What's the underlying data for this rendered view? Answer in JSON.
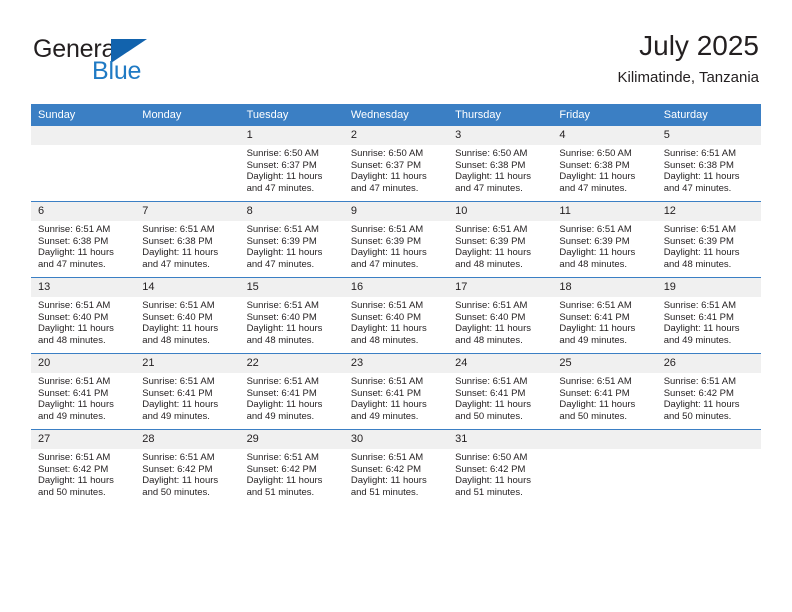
{
  "brand": {
    "name_top": "General",
    "name_bottom": "Blue",
    "logo_icon": "blue-triangle-flag-icon",
    "color_dark": "#231f20",
    "color_blue": "#1f7ac4",
    "color_flag": "#1263ad"
  },
  "header": {
    "title": "July 2025",
    "subtitle": "Kilimatinde, Tanzania"
  },
  "theme": {
    "header_row_bg": "#3b7fc4",
    "daynum_bg": "#f0f0f0",
    "text": "#231f20"
  },
  "calendar": {
    "weekday_headers": [
      "Sunday",
      "Monday",
      "Tuesday",
      "Wednesday",
      "Thursday",
      "Friday",
      "Saturday"
    ],
    "weeks": [
      [
        {
          "day": "",
          "sunrise": "",
          "sunset": "",
          "daylight1": "",
          "daylight2": ""
        },
        {
          "day": "",
          "sunrise": "",
          "sunset": "",
          "daylight1": "",
          "daylight2": ""
        },
        {
          "day": "1",
          "sunrise": "Sunrise: 6:50 AM",
          "sunset": "Sunset: 6:37 PM",
          "daylight1": "Daylight: 11 hours",
          "daylight2": "and 47 minutes."
        },
        {
          "day": "2",
          "sunrise": "Sunrise: 6:50 AM",
          "sunset": "Sunset: 6:37 PM",
          "daylight1": "Daylight: 11 hours",
          "daylight2": "and 47 minutes."
        },
        {
          "day": "3",
          "sunrise": "Sunrise: 6:50 AM",
          "sunset": "Sunset: 6:38 PM",
          "daylight1": "Daylight: 11 hours",
          "daylight2": "and 47 minutes."
        },
        {
          "day": "4",
          "sunrise": "Sunrise: 6:50 AM",
          "sunset": "Sunset: 6:38 PM",
          "daylight1": "Daylight: 11 hours",
          "daylight2": "and 47 minutes."
        },
        {
          "day": "5",
          "sunrise": "Sunrise: 6:51 AM",
          "sunset": "Sunset: 6:38 PM",
          "daylight1": "Daylight: 11 hours",
          "daylight2": "and 47 minutes."
        }
      ],
      [
        {
          "day": "6",
          "sunrise": "Sunrise: 6:51 AM",
          "sunset": "Sunset: 6:38 PM",
          "daylight1": "Daylight: 11 hours",
          "daylight2": "and 47 minutes."
        },
        {
          "day": "7",
          "sunrise": "Sunrise: 6:51 AM",
          "sunset": "Sunset: 6:38 PM",
          "daylight1": "Daylight: 11 hours",
          "daylight2": "and 47 minutes."
        },
        {
          "day": "8",
          "sunrise": "Sunrise: 6:51 AM",
          "sunset": "Sunset: 6:39 PM",
          "daylight1": "Daylight: 11 hours",
          "daylight2": "and 47 minutes."
        },
        {
          "day": "9",
          "sunrise": "Sunrise: 6:51 AM",
          "sunset": "Sunset: 6:39 PM",
          "daylight1": "Daylight: 11 hours",
          "daylight2": "and 47 minutes."
        },
        {
          "day": "10",
          "sunrise": "Sunrise: 6:51 AM",
          "sunset": "Sunset: 6:39 PM",
          "daylight1": "Daylight: 11 hours",
          "daylight2": "and 48 minutes."
        },
        {
          "day": "11",
          "sunrise": "Sunrise: 6:51 AM",
          "sunset": "Sunset: 6:39 PM",
          "daylight1": "Daylight: 11 hours",
          "daylight2": "and 48 minutes."
        },
        {
          "day": "12",
          "sunrise": "Sunrise: 6:51 AM",
          "sunset": "Sunset: 6:39 PM",
          "daylight1": "Daylight: 11 hours",
          "daylight2": "and 48 minutes."
        }
      ],
      [
        {
          "day": "13",
          "sunrise": "Sunrise: 6:51 AM",
          "sunset": "Sunset: 6:40 PM",
          "daylight1": "Daylight: 11 hours",
          "daylight2": "and 48 minutes."
        },
        {
          "day": "14",
          "sunrise": "Sunrise: 6:51 AM",
          "sunset": "Sunset: 6:40 PM",
          "daylight1": "Daylight: 11 hours",
          "daylight2": "and 48 minutes."
        },
        {
          "day": "15",
          "sunrise": "Sunrise: 6:51 AM",
          "sunset": "Sunset: 6:40 PM",
          "daylight1": "Daylight: 11 hours",
          "daylight2": "and 48 minutes."
        },
        {
          "day": "16",
          "sunrise": "Sunrise: 6:51 AM",
          "sunset": "Sunset: 6:40 PM",
          "daylight1": "Daylight: 11 hours",
          "daylight2": "and 48 minutes."
        },
        {
          "day": "17",
          "sunrise": "Sunrise: 6:51 AM",
          "sunset": "Sunset: 6:40 PM",
          "daylight1": "Daylight: 11 hours",
          "daylight2": "and 48 minutes."
        },
        {
          "day": "18",
          "sunrise": "Sunrise: 6:51 AM",
          "sunset": "Sunset: 6:41 PM",
          "daylight1": "Daylight: 11 hours",
          "daylight2": "and 49 minutes."
        },
        {
          "day": "19",
          "sunrise": "Sunrise: 6:51 AM",
          "sunset": "Sunset: 6:41 PM",
          "daylight1": "Daylight: 11 hours",
          "daylight2": "and 49 minutes."
        }
      ],
      [
        {
          "day": "20",
          "sunrise": "Sunrise: 6:51 AM",
          "sunset": "Sunset: 6:41 PM",
          "daylight1": "Daylight: 11 hours",
          "daylight2": "and 49 minutes."
        },
        {
          "day": "21",
          "sunrise": "Sunrise: 6:51 AM",
          "sunset": "Sunset: 6:41 PM",
          "daylight1": "Daylight: 11 hours",
          "daylight2": "and 49 minutes."
        },
        {
          "day": "22",
          "sunrise": "Sunrise: 6:51 AM",
          "sunset": "Sunset: 6:41 PM",
          "daylight1": "Daylight: 11 hours",
          "daylight2": "and 49 minutes."
        },
        {
          "day": "23",
          "sunrise": "Sunrise: 6:51 AM",
          "sunset": "Sunset: 6:41 PM",
          "daylight1": "Daylight: 11 hours",
          "daylight2": "and 49 minutes."
        },
        {
          "day": "24",
          "sunrise": "Sunrise: 6:51 AM",
          "sunset": "Sunset: 6:41 PM",
          "daylight1": "Daylight: 11 hours",
          "daylight2": "and 50 minutes."
        },
        {
          "day": "25",
          "sunrise": "Sunrise: 6:51 AM",
          "sunset": "Sunset: 6:41 PM",
          "daylight1": "Daylight: 11 hours",
          "daylight2": "and 50 minutes."
        },
        {
          "day": "26",
          "sunrise": "Sunrise: 6:51 AM",
          "sunset": "Sunset: 6:42 PM",
          "daylight1": "Daylight: 11 hours",
          "daylight2": "and 50 minutes."
        }
      ],
      [
        {
          "day": "27",
          "sunrise": "Sunrise: 6:51 AM",
          "sunset": "Sunset: 6:42 PM",
          "daylight1": "Daylight: 11 hours",
          "daylight2": "and 50 minutes."
        },
        {
          "day": "28",
          "sunrise": "Sunrise: 6:51 AM",
          "sunset": "Sunset: 6:42 PM",
          "daylight1": "Daylight: 11 hours",
          "daylight2": "and 50 minutes."
        },
        {
          "day": "29",
          "sunrise": "Sunrise: 6:51 AM",
          "sunset": "Sunset: 6:42 PM",
          "daylight1": "Daylight: 11 hours",
          "daylight2": "and 51 minutes."
        },
        {
          "day": "30",
          "sunrise": "Sunrise: 6:51 AM",
          "sunset": "Sunset: 6:42 PM",
          "daylight1": "Daylight: 11 hours",
          "daylight2": "and 51 minutes."
        },
        {
          "day": "31",
          "sunrise": "Sunrise: 6:50 AM",
          "sunset": "Sunset: 6:42 PM",
          "daylight1": "Daylight: 11 hours",
          "daylight2": "and 51 minutes."
        },
        {
          "day": "",
          "sunrise": "",
          "sunset": "",
          "daylight1": "",
          "daylight2": ""
        },
        {
          "day": "",
          "sunrise": "",
          "sunset": "",
          "daylight1": "",
          "daylight2": ""
        }
      ]
    ]
  }
}
